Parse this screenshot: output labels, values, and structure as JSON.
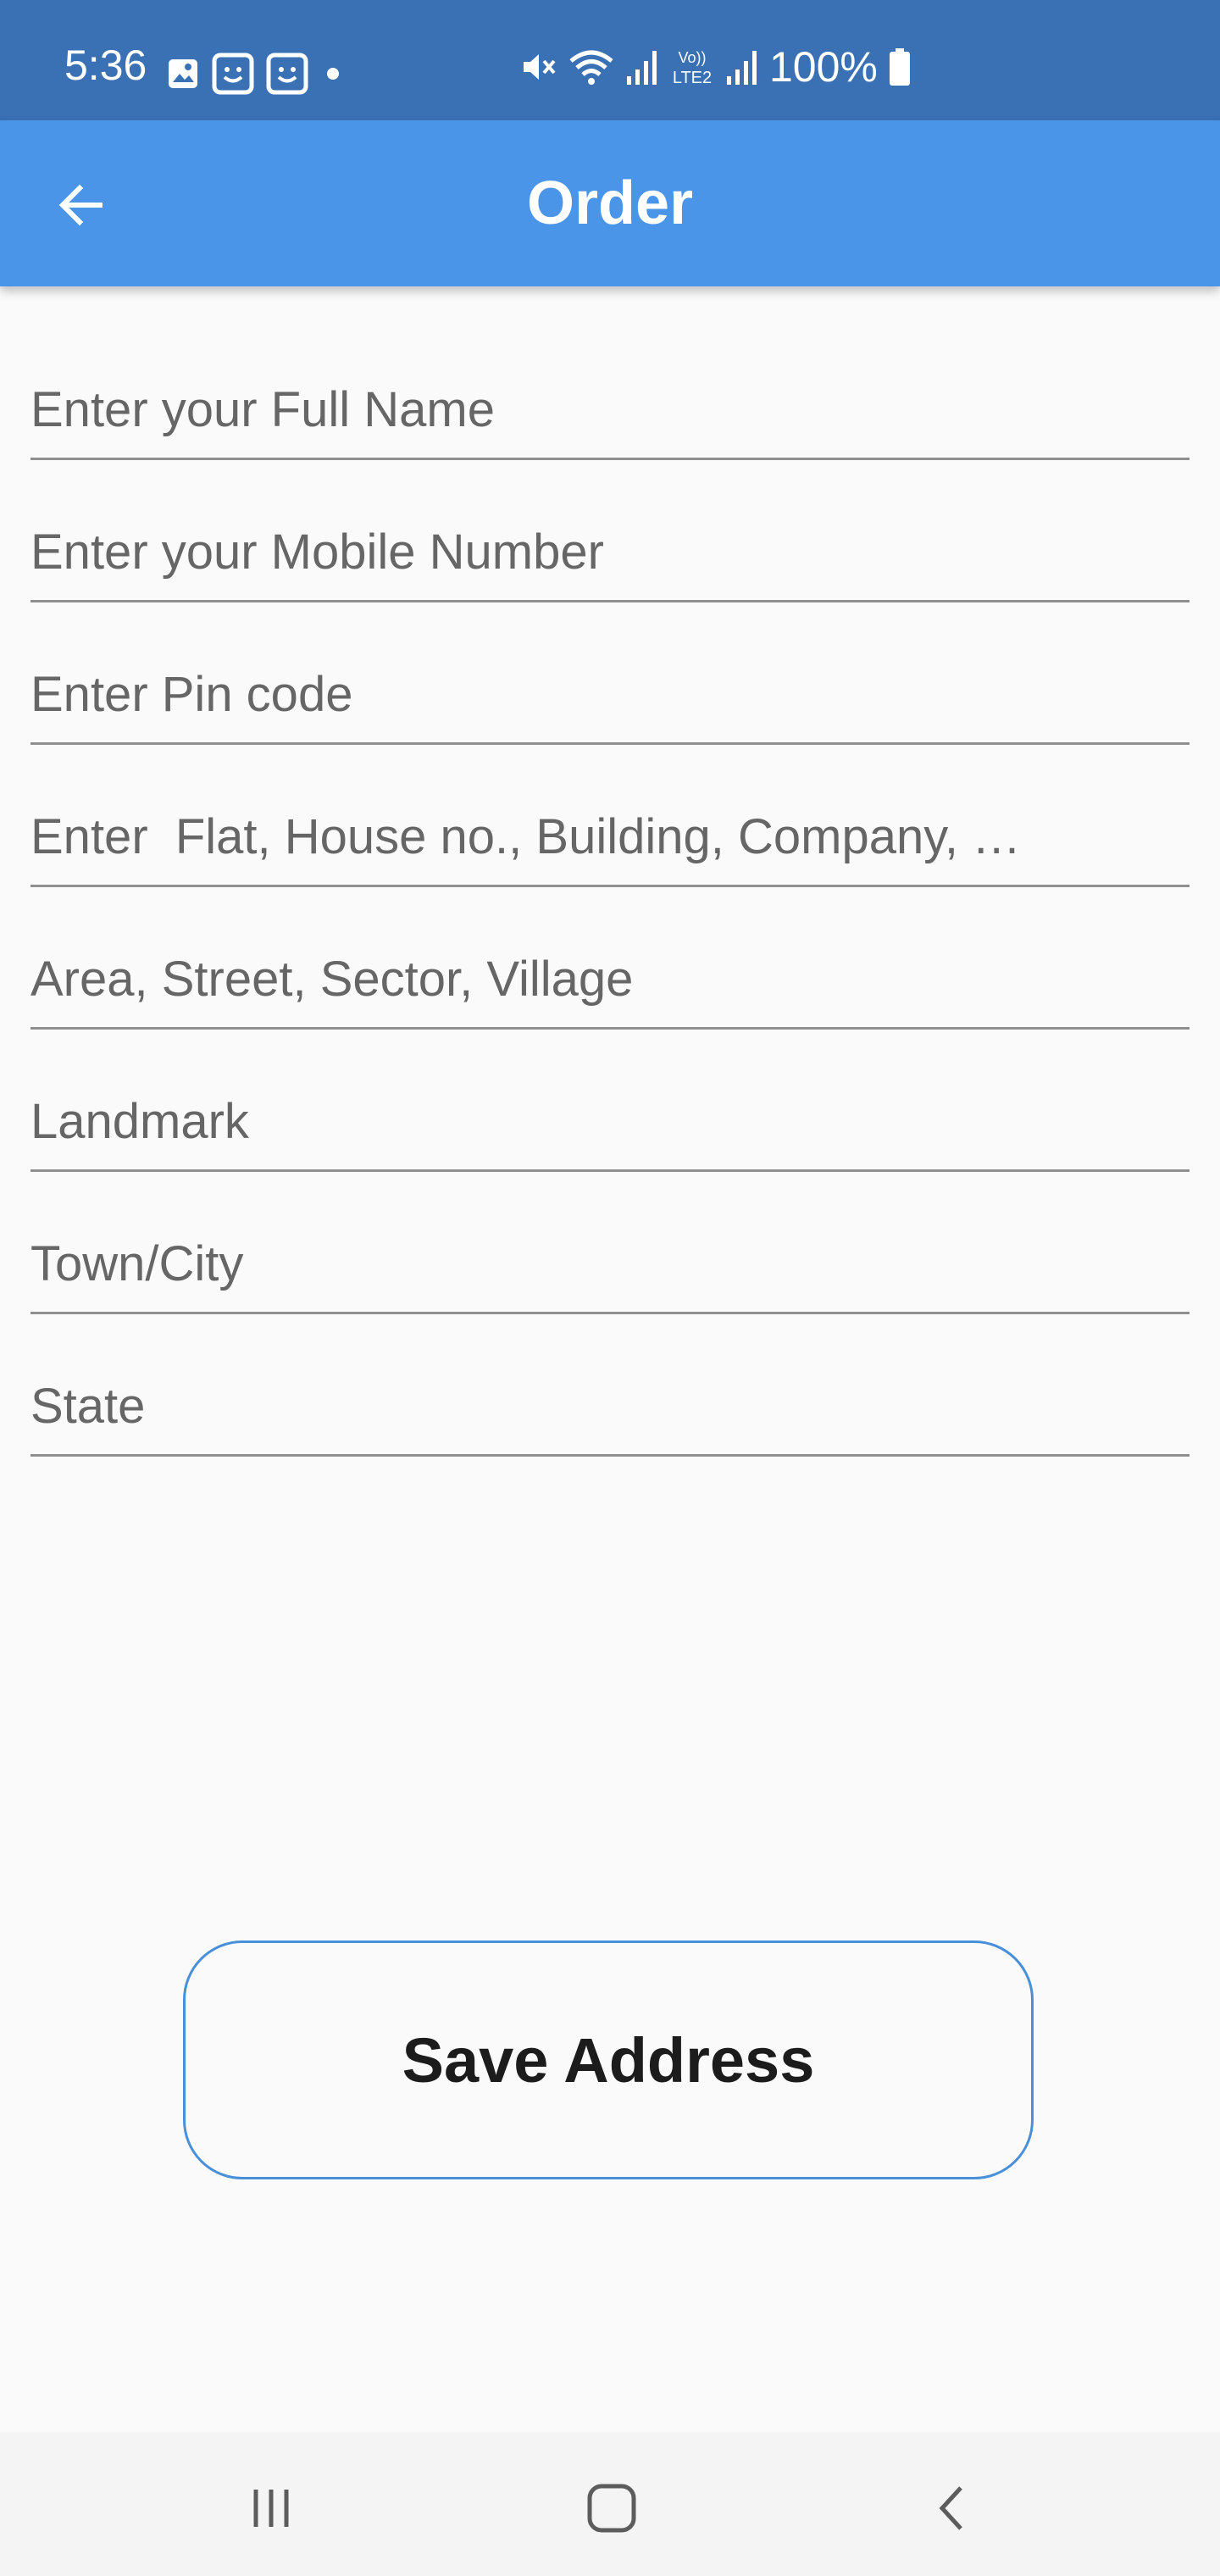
{
  "status_bar": {
    "time": "5:36",
    "battery": "100%",
    "left_icons": [
      "gallery-icon",
      "face-icon",
      "face-icon",
      "dot-icon"
    ],
    "right_icons": [
      "mute-icon",
      "wifi-icon",
      "signal-icon",
      "volte-icon",
      "signal-icon",
      "battery-icon"
    ]
  },
  "app_bar": {
    "title": "Order",
    "back_icon": "arrow-left-icon"
  },
  "form": {
    "full_name_placeholder": "Enter your Full Name",
    "mobile_placeholder": "Enter your Mobile Number",
    "pin_placeholder": "Enter Pin code",
    "flat_placeholder": "Enter  Flat, House no., Building, Company, …",
    "area_placeholder": "Area, Street, Sector, Village",
    "landmark_placeholder": "Landmark",
    "city_placeholder": "Town/City",
    "state_placeholder": "State"
  },
  "save_button": {
    "label": "Save Address"
  },
  "nav_bar": {
    "icons": [
      "recent-apps-icon",
      "home-icon",
      "back-icon"
    ]
  },
  "colors": {
    "status_bar": "#3a70b4",
    "app_bar": "#4a95e8",
    "button_border": "#4a90d9",
    "background": "#fafafa"
  }
}
